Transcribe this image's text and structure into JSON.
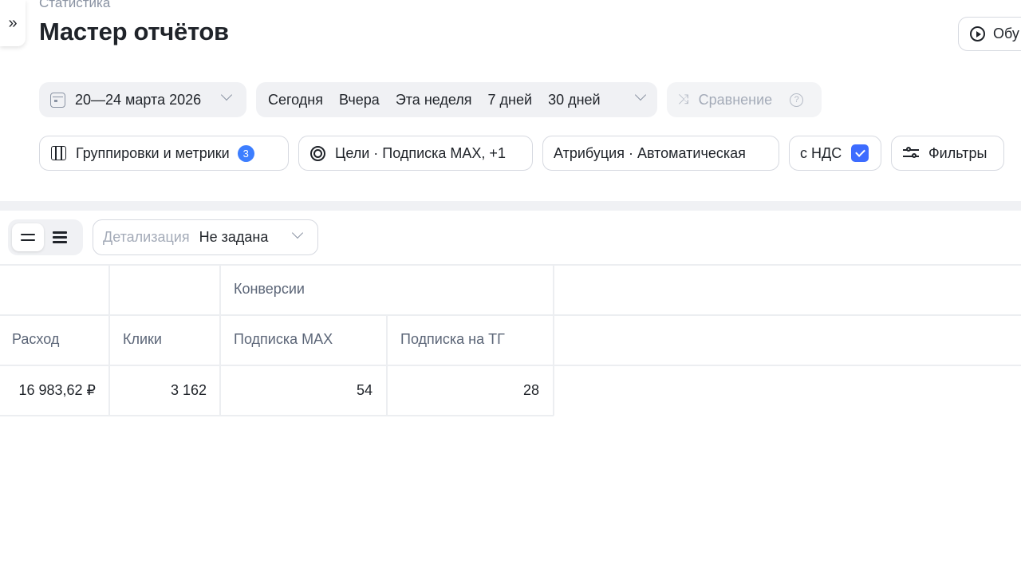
{
  "header": {
    "breadcrumb": "Статистика",
    "title": "Мастер отчётов",
    "training_label": "Обу"
  },
  "date_range": {
    "label": "20—24 марта 2026"
  },
  "periods": [
    "Сегодня",
    "Вчера",
    "Эта неделя",
    "7 дней",
    "30 дней"
  ],
  "comparison": {
    "label": "Сравнение",
    "help": "?"
  },
  "filters": {
    "groupings_label": "Группировки и метрики",
    "groupings_count": "3",
    "goals_label": "Цели · Подписка MAX, +1",
    "attribution_label": "Атрибуция · Автоматическая",
    "vat_label": "с НДС",
    "vat_checked": true,
    "filters_label": "Фильтры"
  },
  "toolbar": {
    "detail_label": "Детализация",
    "detail_value": "Не задана"
  },
  "table": {
    "group_header": "Конверсии",
    "columns": [
      "Расход",
      "Клики",
      "Подписка MAX",
      "Подписка на ТГ"
    ],
    "rows": [
      [
        "16 983,62 ₽",
        "3 162",
        "54",
        "28"
      ]
    ]
  },
  "colors": {
    "accent": "#3d7eff",
    "checkbox": "#3d6cff",
    "chip_bg": "#f0f1f4",
    "border": "#d6d9e0",
    "muted_text": "#8a93a3"
  },
  "icons": [
    "expand-icon",
    "play-icon",
    "calendar-icon",
    "chevron-down-icon",
    "shuffle-icon",
    "help-icon",
    "columns-icon",
    "target-icon",
    "checkbox-icon",
    "sliders-icon",
    "list-view-icon",
    "dense-list-view-icon"
  ]
}
